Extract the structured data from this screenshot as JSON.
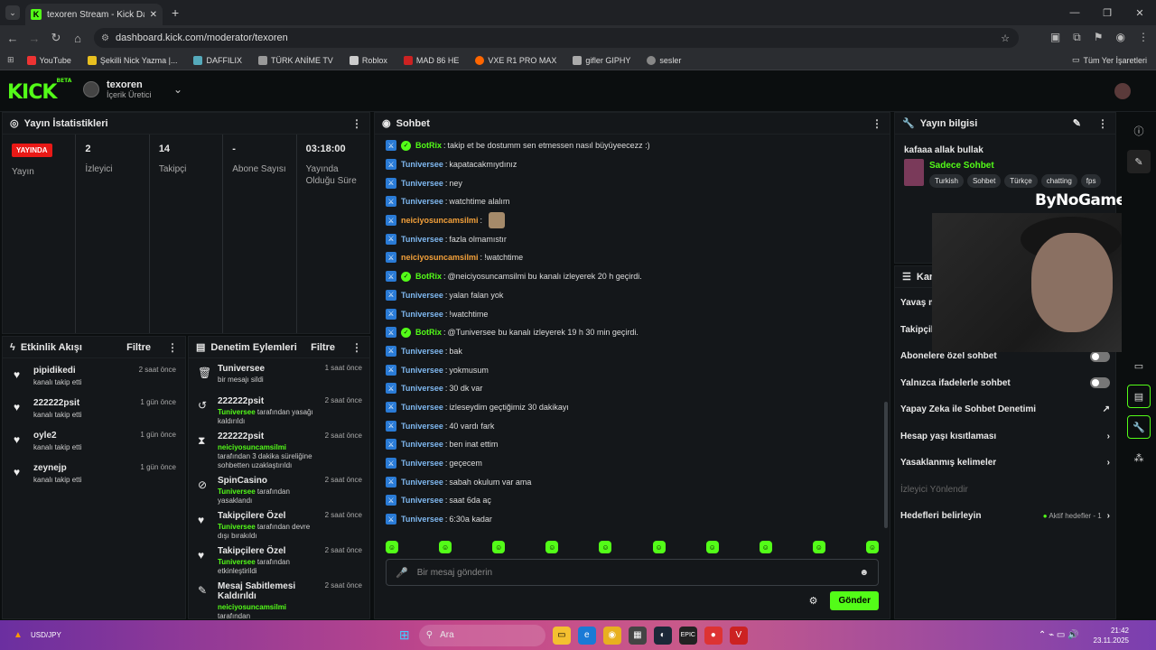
{
  "browser": {
    "tab_title": "texoren Stream - Kick Dashboa",
    "url": "dashboard.kick.com/moderator/texoren",
    "bookmarks": [
      "YouTube",
      "Şekilli Nick Yazma |...",
      "DAFFILIX",
      "TÜRK ANİME TV",
      "Roblox",
      "MAD 86 HE",
      "VXE R1 PRO MAX",
      "gifler GIPHY",
      "sesler"
    ],
    "bookmarks_folder": "Tüm Yer İşaretleri"
  },
  "header": {
    "logo": "KICK",
    "logo_badge": "BETA",
    "channel_name": "texoren",
    "channel_role": "İçerik Üretici"
  },
  "stats": {
    "title": "Yayın İstatistikleri",
    "live_badge": "YAYINDA",
    "items": [
      {
        "value": "",
        "label": "Yayın"
      },
      {
        "value": "2",
        "label": "İzleyici"
      },
      {
        "value": "14",
        "label": "Takipçi"
      },
      {
        "value": "-",
        "label": "Abone Sayısı"
      },
      {
        "value": "03:18:00",
        "label": "Yayında Olduğu Süre"
      }
    ]
  },
  "activity": {
    "title": "Etkinlik Akışı",
    "filter": "Filtre",
    "items": [
      {
        "name": "pipidikedi",
        "desc": "kanalı takip etti",
        "time": "2 saat önce"
      },
      {
        "name": "222222psit",
        "desc": "kanalı takip etti",
        "time": "1 gün önce"
      },
      {
        "name": "oyle2",
        "desc": "kanalı takip etti",
        "time": "1 gün önce"
      },
      {
        "name": "zeynejp",
        "desc": "kanalı takip etti",
        "time": "1 gün önce"
      }
    ]
  },
  "modactions": {
    "title": "Denetim Eylemleri",
    "filter": "Filtre",
    "items": [
      {
        "icon": "🗑",
        "name": "Tuniversee",
        "actor": "",
        "desc": "bir mesajı sildi",
        "time": "1 saat önce"
      },
      {
        "icon": "↺",
        "name": "222222psit",
        "actor": "Tuniversee",
        "desc": "tarafından yasağı kaldırıldı",
        "time": "2 saat önce"
      },
      {
        "icon": "⧗",
        "name": "222222psit",
        "actor": "neiciyosuncamsilmi",
        "desc": "tarafından 3 dakika süreliğine sohbetten uzaklaştırıldı",
        "time": "2 saat önce"
      },
      {
        "icon": "⊘",
        "name": "SpinCasino",
        "actor": "Tuniversee",
        "desc": "tarafından yasaklandı",
        "time": "2 saat önce"
      },
      {
        "icon": "♥",
        "name": "Takipçilere Özel",
        "actor": "Tuniversee",
        "desc": "tarafından devre dışı bırakıldı",
        "time": "2 saat önce"
      },
      {
        "icon": "♥",
        "name": "Takipçilere Özel",
        "actor": "Tuniversee",
        "desc": "tarafından etkinleştirildi",
        "time": "2 saat önce"
      },
      {
        "icon": "✎",
        "name": "Mesaj Sabitlemesi Kaldırıldı",
        "actor": "neiciyosuncamsilmi",
        "desc": "tarafından",
        "time": "2 saat önce"
      }
    ]
  },
  "chat": {
    "title": "Sohbet",
    "messages": [
      {
        "user": "BotRix",
        "color": "#53fc18",
        "verified": true,
        "text": "takip et be dostumm sen etmessen nasıl büyüyeecezz :)"
      },
      {
        "user": "Tuniversee",
        "color": "#7fb8f0",
        "verified": false,
        "text": "kapatacakmıydınız"
      },
      {
        "user": "Tuniversee",
        "color": "#7fb8f0",
        "verified": false,
        "text": "ney"
      },
      {
        "user": "Tuniversee",
        "color": "#7fb8f0",
        "verified": false,
        "text": "watchtime alalım"
      },
      {
        "user": "neiciyosuncamsilmi",
        "color": "#f4a13a",
        "verified": false,
        "text": "",
        "emote": true
      },
      {
        "user": "Tuniversee",
        "color": "#7fb8f0",
        "verified": false,
        "text": "fazla olmamıstır"
      },
      {
        "user": "neiciyosuncamsilmi",
        "color": "#f4a13a",
        "verified": false,
        "text": "!watchtime"
      },
      {
        "user": "BotRix",
        "color": "#53fc18",
        "verified": true,
        "text": "@neiciyosuncamsilmi bu kanalı izleyerek 20 h geçirdi."
      },
      {
        "user": "Tuniversee",
        "color": "#7fb8f0",
        "verified": false,
        "text": "yalan falan yok"
      },
      {
        "user": "Tuniversee",
        "color": "#7fb8f0",
        "verified": false,
        "text": "!watchtime"
      },
      {
        "user": "BotRix",
        "color": "#53fc18",
        "verified": true,
        "text": "@Tuniversee bu kanalı izleyerek 19 h 30 min geçirdi."
      },
      {
        "user": "Tuniversee",
        "color": "#7fb8f0",
        "verified": false,
        "text": "bak"
      },
      {
        "user": "Tuniversee",
        "color": "#7fb8f0",
        "verified": false,
        "text": "yokmusum"
      },
      {
        "user": "Tuniversee",
        "color": "#7fb8f0",
        "verified": false,
        "text": "30 dk var"
      },
      {
        "user": "Tuniversee",
        "color": "#7fb8f0",
        "verified": false,
        "text": "izleseydim geçtiğimiz 30 dakikayı"
      },
      {
        "user": "Tuniversee",
        "color": "#7fb8f0",
        "verified": false,
        "text": "40 vardı fark"
      },
      {
        "user": "Tuniversee",
        "color": "#7fb8f0",
        "verified": false,
        "text": "ben inat ettim"
      },
      {
        "user": "Tuniversee",
        "color": "#7fb8f0",
        "verified": false,
        "text": "geçecem"
      },
      {
        "user": "Tuniversee",
        "color": "#7fb8f0",
        "verified": false,
        "text": "sabah okulum var ama"
      },
      {
        "user": "Tuniversee",
        "color": "#7fb8f0",
        "verified": false,
        "text": "saat 6da aç"
      },
      {
        "user": "Tuniversee",
        "color": "#7fb8f0",
        "verified": false,
        "text": "6:30a kadar"
      }
    ],
    "placeholder": "Bir mesaj gönderin",
    "send_label": "Gönder"
  },
  "streaminfo": {
    "title": "Yayın bilgisi",
    "stream_title": "kafaaa allak bullak",
    "category": "Sadece Sohbet",
    "tags": [
      "Turkish",
      "Sohbet",
      "Türkçe",
      "chatting",
      "fps"
    ]
  },
  "overlay": {
    "brand": "ByNoGame"
  },
  "channelsettings": {
    "title": "Kana",
    "rows": [
      {
        "label": "Yavaş m",
        "type": "text"
      },
      {
        "label": "Takipçil",
        "type": "text"
      },
      {
        "label": "Abonelere özel sohbet",
        "type": "toggle"
      },
      {
        "label": "Yalnızca ifadelerle sohbet",
        "type": "toggle"
      },
      {
        "label": "Yapay Zeka ile Sohbet Denetimi",
        "type": "ext"
      },
      {
        "label": "Hesap yaşı kısıtlaması",
        "type": "arrow"
      },
      {
        "label": "Yasaklanmış kelimeler",
        "type": "arrow"
      },
      {
        "label": "İzleyici Yönlendir",
        "type": "dim"
      },
      {
        "label": "Hedefleri belirleyin",
        "type": "goal",
        "extra": "Aktif hedefler - 1"
      }
    ]
  },
  "taskbar": {
    "ticker": "USD/JPY",
    "search": "Ara",
    "time": "21:42",
    "date": "23.11.2025"
  }
}
